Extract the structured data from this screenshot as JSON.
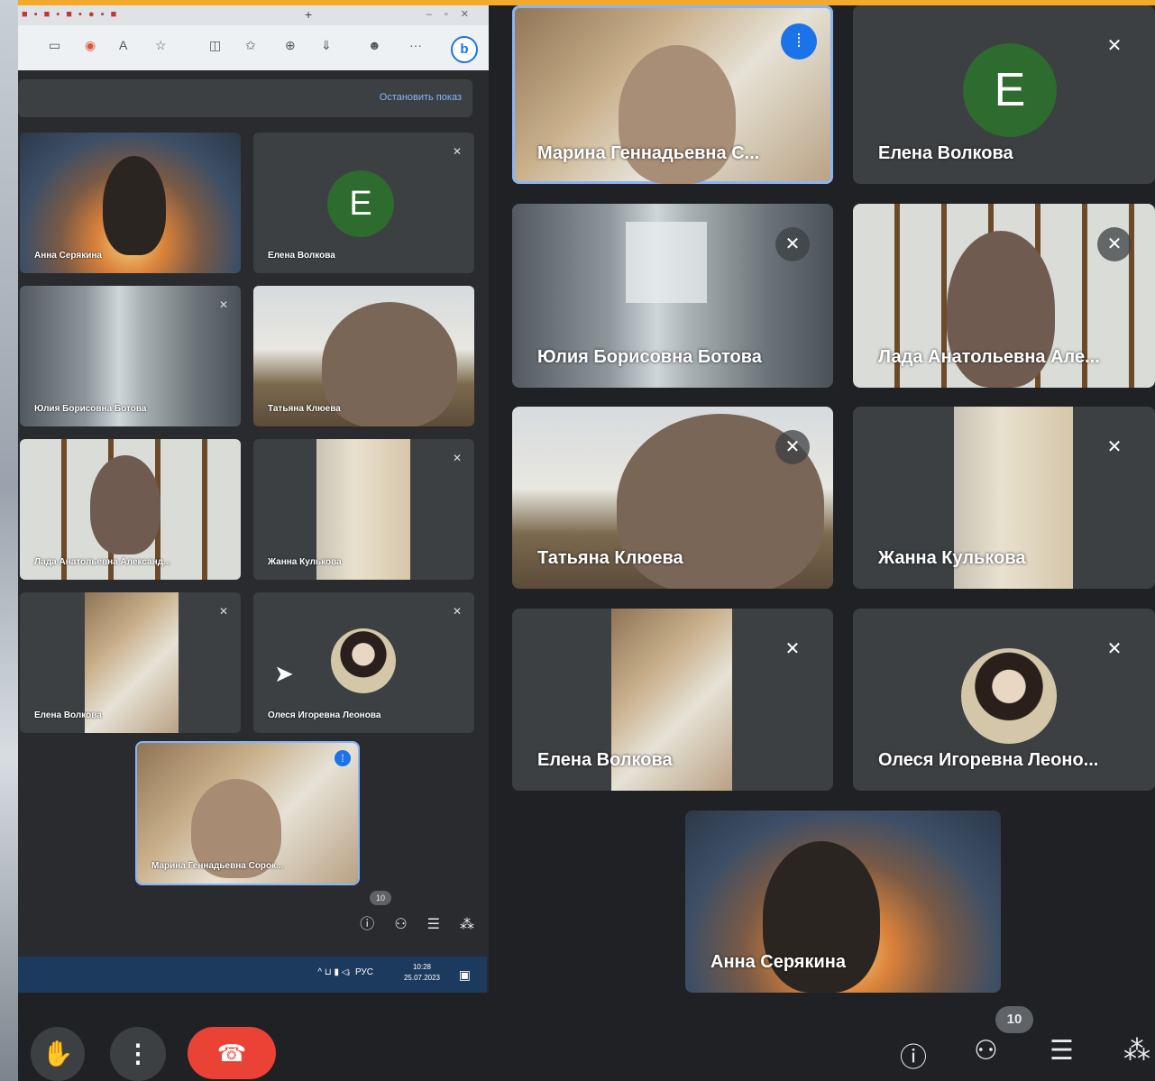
{
  "browser": {
    "new_tab": "+",
    "more": "···",
    "bing": "b"
  },
  "presenting": {
    "stop_label": "Остановить показ"
  },
  "left_pane": {
    "participants": [
      {
        "name": "Анна Серякина"
      },
      {
        "name": "Елена Волкова",
        "initial": "Е"
      },
      {
        "name": "Юлия Борисовна Ботова"
      },
      {
        "name": "Татьяна Клюева"
      },
      {
        "name": "Лада Анатольевна Александ..."
      },
      {
        "name": "Жанна Кулькова"
      },
      {
        "name": "Елена Волкова"
      },
      {
        "name": "Олеся Игоревна Леонова"
      },
      {
        "name": "Марина Геннадьевна Сорок..."
      }
    ],
    "people_count": "10",
    "taskbar": {
      "lang": "РУС",
      "time": "10:28",
      "date": "25.07.2023"
    }
  },
  "grid": {
    "tiles": [
      {
        "name": "Марина Геннадьевна С..."
      },
      {
        "name": "Елена Волкова",
        "initial": "Е"
      },
      {
        "name": "Юлия Борисовна Ботова"
      },
      {
        "name": "Лада Анатольевна Але..."
      },
      {
        "name": "Татьяна Клюева"
      },
      {
        "name": "Жанна Кулькова"
      },
      {
        "name": "Елена Волкова"
      },
      {
        "name": "Олеся Игоревна Леоно..."
      },
      {
        "name": "Анна Серякина"
      }
    ]
  },
  "controls": {
    "people_count": "10"
  },
  "colors": {
    "accent_bar": "#f4a92a",
    "meet_bg": "#202124",
    "hangup": "#ea4335",
    "speaking": "#1a73e8",
    "avatar": "#2e6b2e"
  }
}
